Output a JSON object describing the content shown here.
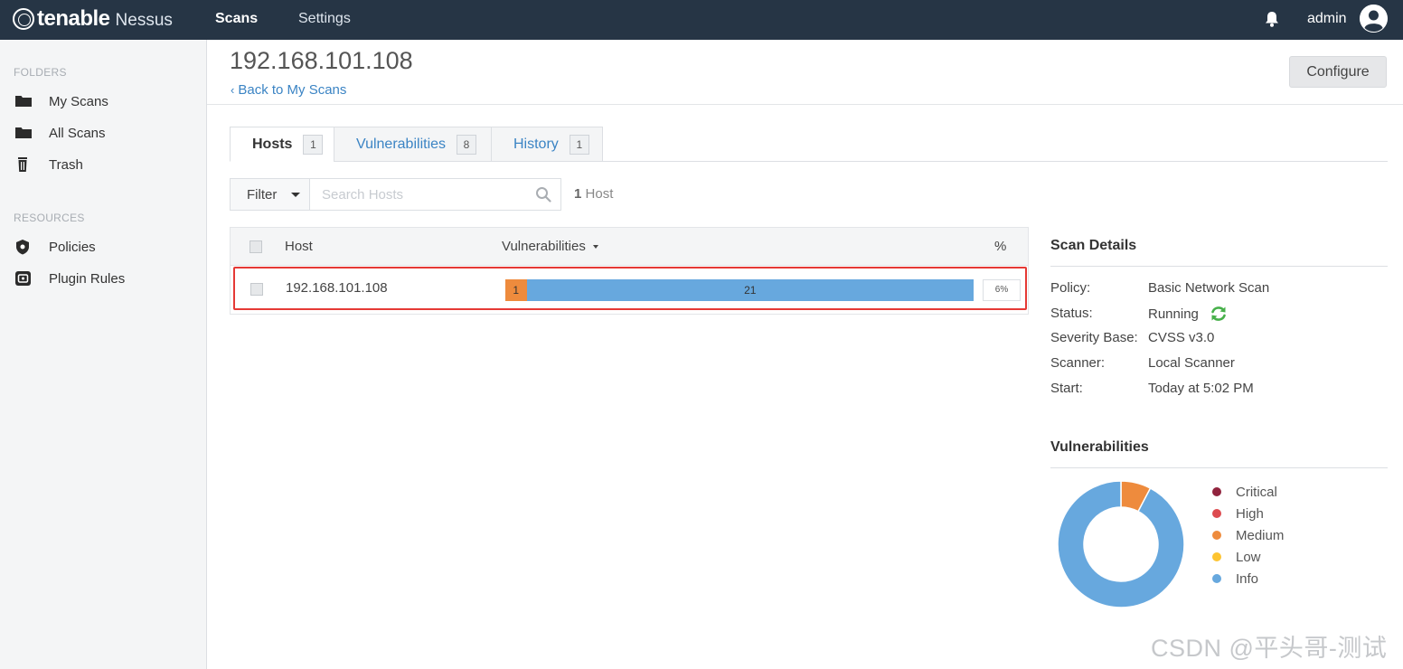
{
  "header": {
    "brand": "tenable",
    "product": "Nessus",
    "nav": [
      {
        "label": "Scans",
        "active": true
      },
      {
        "label": "Settings",
        "active": false
      }
    ],
    "user": "admin"
  },
  "sidebar": {
    "folders_heading": "FOLDERS",
    "folders": [
      {
        "label": "My Scans",
        "icon": "folder-icon"
      },
      {
        "label": "All Scans",
        "icon": "folder-icon"
      },
      {
        "label": "Trash",
        "icon": "trash-icon"
      }
    ],
    "resources_heading": "RESOURCES",
    "resources": [
      {
        "label": "Policies",
        "icon": "shield-icon"
      },
      {
        "label": "Plugin Rules",
        "icon": "plugin-icon"
      }
    ]
  },
  "page": {
    "title": "192.168.101.108",
    "back_link": "Back to My Scans",
    "configure_label": "Configure"
  },
  "tabs": [
    {
      "label": "Hosts",
      "count": "1",
      "active": true
    },
    {
      "label": "Vulnerabilities",
      "count": "8",
      "active": false
    },
    {
      "label": "History",
      "count": "1",
      "active": false
    }
  ],
  "filter": {
    "label": "Filter",
    "search_placeholder": "Search Hosts",
    "search_value": "",
    "count_number": "1",
    "count_label": "Host"
  },
  "hosts_table": {
    "columns": [
      "Host",
      "Vulnerabilities",
      "%"
    ],
    "rows": [
      {
        "host": "192.168.101.108",
        "percent": "6%",
        "segments": [
          {
            "severity": "Medium",
            "count": 1,
            "label": "1",
            "color": "#ee8b3d"
          },
          {
            "severity": "Info",
            "count": 21,
            "label": "21",
            "color": "#67a8de"
          }
        ]
      }
    ]
  },
  "scan_details": {
    "title": "Scan Details",
    "items": [
      {
        "label": "Policy:",
        "value": "Basic Network Scan"
      },
      {
        "label": "Status:",
        "value": "Running"
      },
      {
        "label": "Severity Base:",
        "value": "CVSS v3.0"
      },
      {
        "label": "Scanner:",
        "value": "Local Scanner"
      },
      {
        "label": "Start:",
        "value": "Today at 5:02 PM"
      }
    ]
  },
  "vulnerabilities_chart": {
    "title": "Vulnerabilities",
    "slices": [
      {
        "name": "Critical",
        "value": 0,
        "color": "#91243e"
      },
      {
        "name": "High",
        "value": 0,
        "color": "#dd4b50"
      },
      {
        "name": "Medium",
        "value": 1,
        "color": "#ee8b3d"
      },
      {
        "name": "Low",
        "value": 0,
        "color": "#fdc431"
      },
      {
        "name": "Info",
        "value": 12,
        "color": "#67a8de"
      }
    ]
  },
  "watermark": "CSDN @平头哥-测试"
}
